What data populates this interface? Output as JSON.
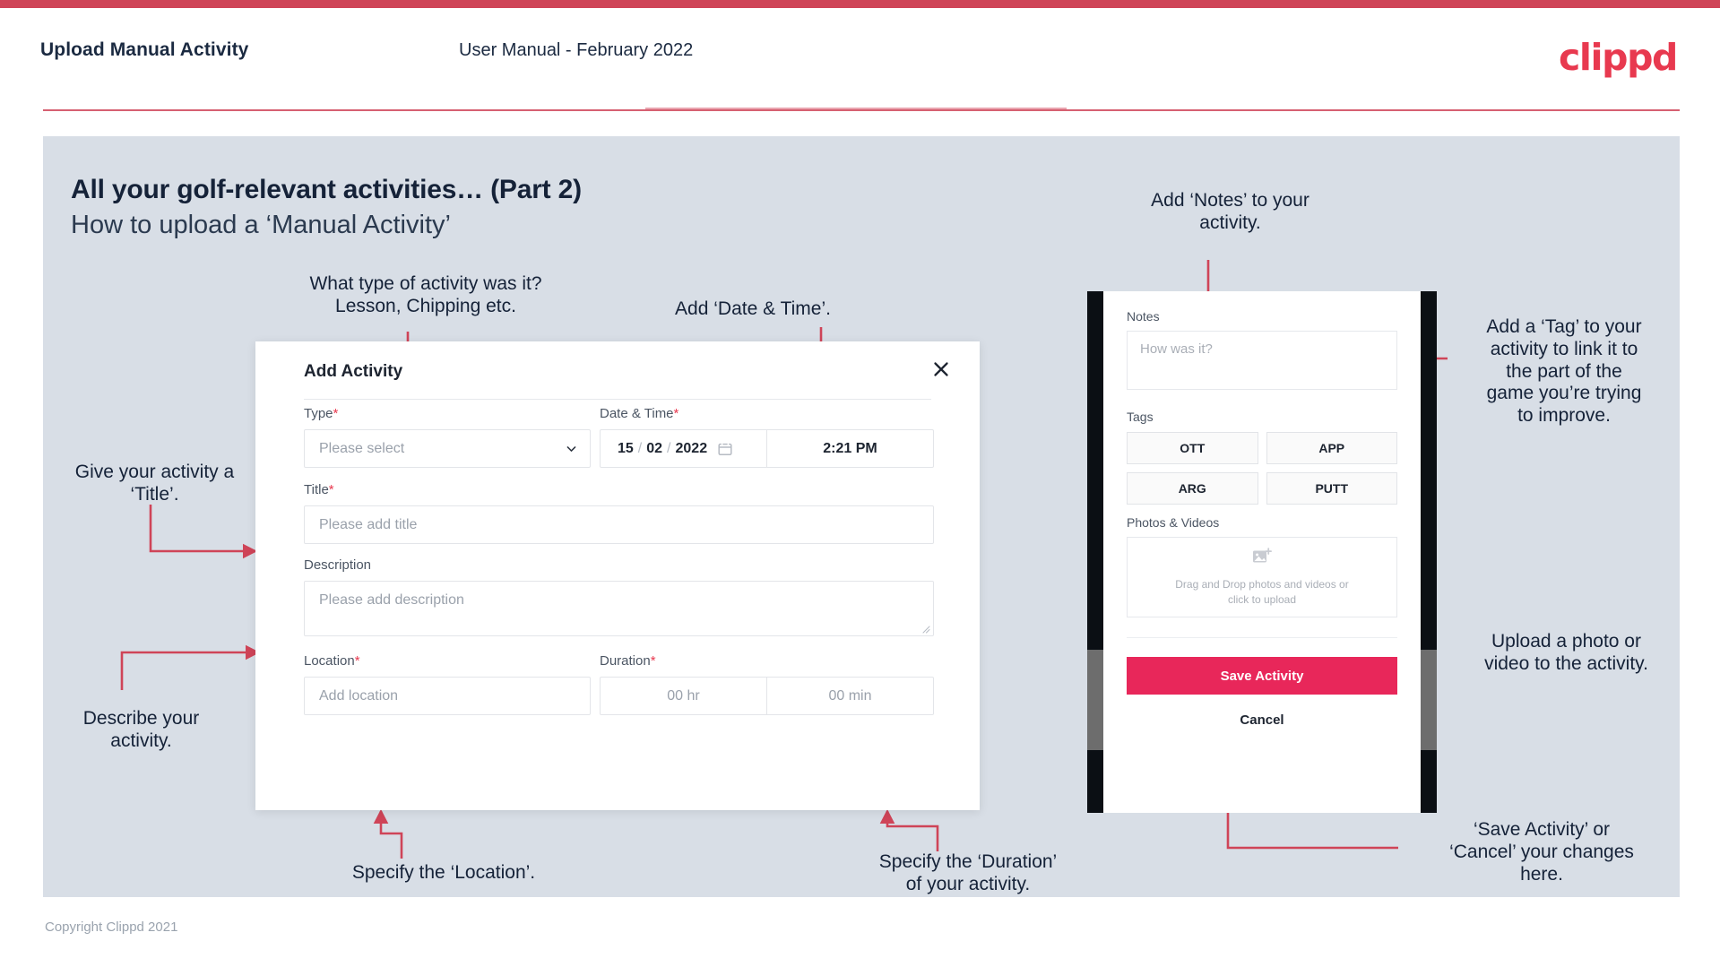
{
  "header": {
    "left_title": "Upload Manual Activity",
    "center_title": "User Manual - February 2022",
    "logo": "clippd"
  },
  "slide": {
    "title": "All your golf-relevant activities… (Part 2)",
    "subtitle": "How to upload a ‘Manual Activity’",
    "copyright": "Copyright Clippd 2021"
  },
  "colors": {
    "accent_pink": "#cf4458",
    "logo_red": "#e8394f",
    "save_button": "#e8275a",
    "panel_bg": "#d8dee6",
    "dark_text": "#152238",
    "required_star": "#e8394f"
  },
  "dialog": {
    "title": "Add Activity",
    "close_icon": "close-icon",
    "fields": {
      "type": {
        "label": "Type",
        "required": "*",
        "placeholder": "Please select",
        "chevron_icon": "chevron-down-icon"
      },
      "datetime": {
        "label": "Date & Time",
        "required": "*",
        "day": "15",
        "sep1": "/",
        "month": "02",
        "sep2": "/",
        "year": "2022",
        "calendar_icon": "calendar-icon",
        "time": "2:21 PM"
      },
      "title": {
        "label": "Title",
        "required": "*",
        "placeholder": "Please add title"
      },
      "description": {
        "label": "Description",
        "required": "",
        "placeholder": "Please add description"
      },
      "location": {
        "label": "Location",
        "required": "*",
        "placeholder": "Add location"
      },
      "duration": {
        "label": "Duration",
        "required": "*",
        "hours_placeholder": "00 hr",
        "minutes_placeholder": "00 min"
      }
    }
  },
  "phone": {
    "notes": {
      "label": "Notes",
      "placeholder": "How was it?"
    },
    "tags": {
      "label": "Tags",
      "items": [
        "OTT",
        "APP",
        "ARG",
        "PUTT"
      ]
    },
    "photos": {
      "label": "Photos & Videos",
      "icon": "add-image-icon",
      "line1": "Drag and Drop photos and videos or",
      "line2": "click to upload"
    },
    "save_label": "Save Activity",
    "cancel_label": "Cancel"
  },
  "annotations": {
    "type": "What type of activity was it?\nLesson, Chipping etc.",
    "datetime": "Add ‘Date & Time’.",
    "title": "Give your activity a\n‘Title’.",
    "description": "Describe your\nactivity.",
    "location": "Specify the ‘Location’.",
    "duration": "Specify the ‘Duration’\nof your activity.",
    "notes": "Add ‘Notes’ to your\nactivity.",
    "tags": "Add a ‘Tag’ to your\nactivity to link it to\nthe part of the\ngame you’re trying\nto improve.",
    "upload": "Upload a photo or\nvideo to the activity.",
    "save_cancel": "‘Save Activity’ or\n‘Cancel’ your changes\nhere."
  }
}
